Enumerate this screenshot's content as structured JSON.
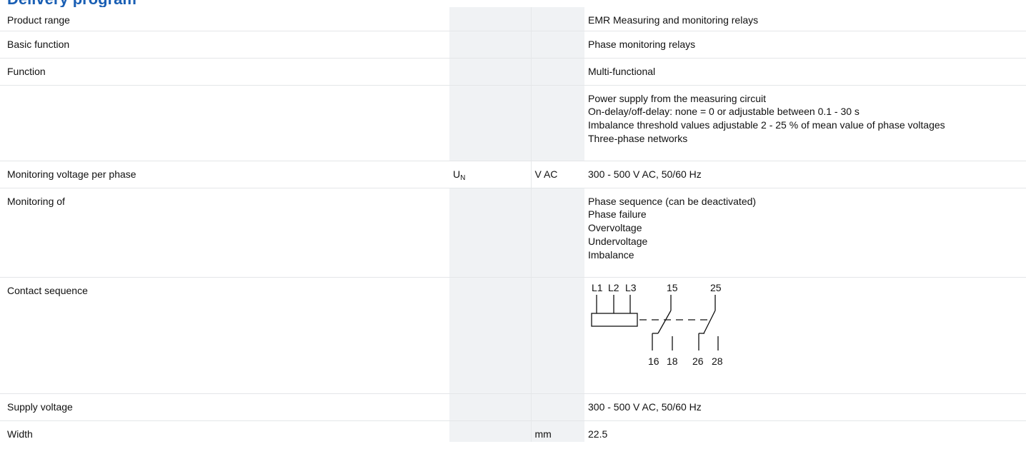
{
  "page": {
    "heading": "Delivery program"
  },
  "rows": [
    {
      "label": "Product range",
      "symbol": "",
      "unit": "",
      "value": [
        "EMR Measuring and monitoring relays"
      ]
    },
    {
      "label": "Basic function",
      "symbol": "",
      "unit": "",
      "value": [
        "Phase monitoring relays"
      ]
    },
    {
      "label": "Function",
      "symbol": "",
      "unit": "",
      "value": [
        "Multi-functional"
      ]
    },
    {
      "label": "",
      "symbol": "",
      "unit": "",
      "value": [
        "Power supply from the measuring circuit",
        "On-delay/off-delay: none = 0 or adjustable between 0.1 - 30 s",
        "Imbalance threshold values adjustable 2 - 25 % of mean value of phase voltages",
        "Three-phase networks"
      ]
    },
    {
      "label": "Monitoring voltage per phase",
      "symbol": {
        "base": "U",
        "sub": "N"
      },
      "unit": "V AC",
      "value": [
        "300 - 500 V AC, 50/60 Hz"
      ]
    },
    {
      "label": "Monitoring of",
      "symbol": "",
      "unit": "",
      "value": [
        "Phase sequence (can be deactivated)",
        "Phase failure",
        "Overvoltage",
        "Undervoltage",
        "Imbalance"
      ]
    },
    {
      "label": "Contact sequence",
      "symbol": "",
      "unit": "",
      "value": []
    },
    {
      "label": "Supply voltage",
      "symbol": "",
      "unit": "",
      "value": [
        "300 - 500 V AC, 50/60 Hz"
      ]
    },
    {
      "label": "Width",
      "symbol": "",
      "unit": "mm",
      "value": [
        "22.5"
      ]
    }
  ],
  "diagram": {
    "top_terminals": [
      "L1",
      "L2",
      "L3",
      "15",
      "25"
    ],
    "bottom_terminals": [
      "16",
      "18",
      "26",
      "28"
    ]
  }
}
